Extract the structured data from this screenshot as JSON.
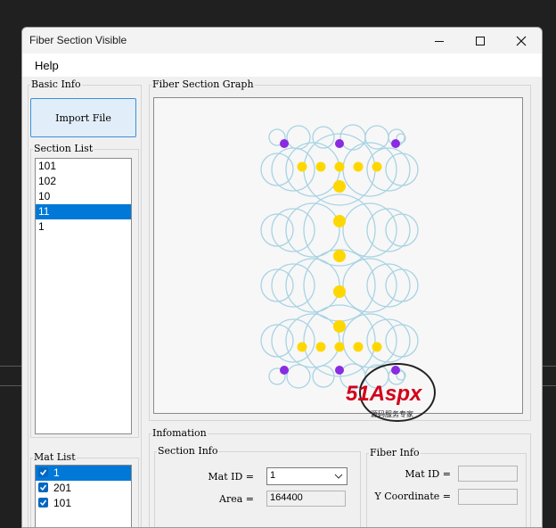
{
  "window": {
    "title": "Fiber Section Visible"
  },
  "menu": {
    "help": "Help"
  },
  "basic_info": {
    "label": "Basic Info",
    "import_button": "Import File",
    "section_list_label": "Section List",
    "sections": [
      "101",
      "102",
      "10",
      "11",
      "1"
    ],
    "selected_section": "11",
    "mat_list_label": "Mat List",
    "mats": [
      "1",
      "201",
      "101"
    ],
    "selected_mat": "1"
  },
  "graph": {
    "label": "Fiber Section Graph"
  },
  "information": {
    "label": "Infomation",
    "section_info": {
      "label": "Section Info",
      "mat_id_label": "Mat ID =",
      "mat_id_value": "1",
      "area_label": "Area =",
      "area_value": "164400"
    },
    "fiber_info": {
      "label": "Fiber Info",
      "mat_id_label": "Mat ID =",
      "mat_id_value": "",
      "y_coord_label": "Y Coordinate =",
      "y_coord_value": ""
    }
  },
  "watermark": {
    "brand": "51Aspx",
    "tagline": "源码服务专家"
  },
  "colors": {
    "circle": "#a8d3e3",
    "rebar": "#ffd700",
    "corner": "#8a2be2",
    "selection": "#0078d7"
  }
}
